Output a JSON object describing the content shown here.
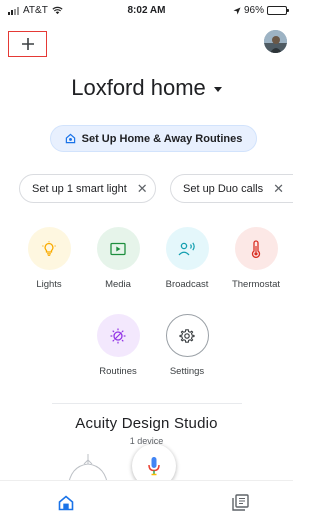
{
  "status_bar": {
    "carrier": "AT&T",
    "time": "8:02 AM",
    "battery_percent": "96%",
    "battery_level": 0.96,
    "icons": [
      "signal-icon",
      "wifi-icon",
      "location-arrow-icon",
      "battery-icon"
    ]
  },
  "header": {
    "add_icon": "plus-icon",
    "home_name": "Loxford home"
  },
  "routines_banner": {
    "label": "Set Up Home & Away Routines",
    "icon": "home-routine-icon"
  },
  "chips": [
    {
      "label": "Set up 1 smart light",
      "close": "✕"
    },
    {
      "label": "Set up Duo calls",
      "close": "✕"
    }
  ],
  "actions": [
    {
      "label": "Lights",
      "icon": "lightbulb-icon",
      "bg": "#fef7e0",
      "color": "#f9ab00"
    },
    {
      "label": "Media",
      "icon": "media-play-icon",
      "bg": "#e6f4ea",
      "color": "#1e8e3e"
    },
    {
      "label": "Broadcast",
      "icon": "broadcast-icon",
      "bg": "#e4f7fb",
      "color": "#129eaf"
    },
    {
      "label": "Thermostat",
      "icon": "thermostat-icon",
      "bg": "#fce8e6",
      "color": "#d93025"
    },
    {
      "label": "Routines",
      "icon": "routines-icon",
      "bg": "#f3e8fd",
      "color": "#9334e6"
    },
    {
      "label": "Settings",
      "icon": "settings-gear-icon",
      "bg": "#ffffff",
      "color": "#3c4043"
    }
  ],
  "room": {
    "name": "Acuity Design Studio",
    "device_count": "1 device"
  },
  "bottom_nav": {
    "items": [
      "home-icon",
      "feed-icon"
    ],
    "accent": "#1a73e8"
  }
}
